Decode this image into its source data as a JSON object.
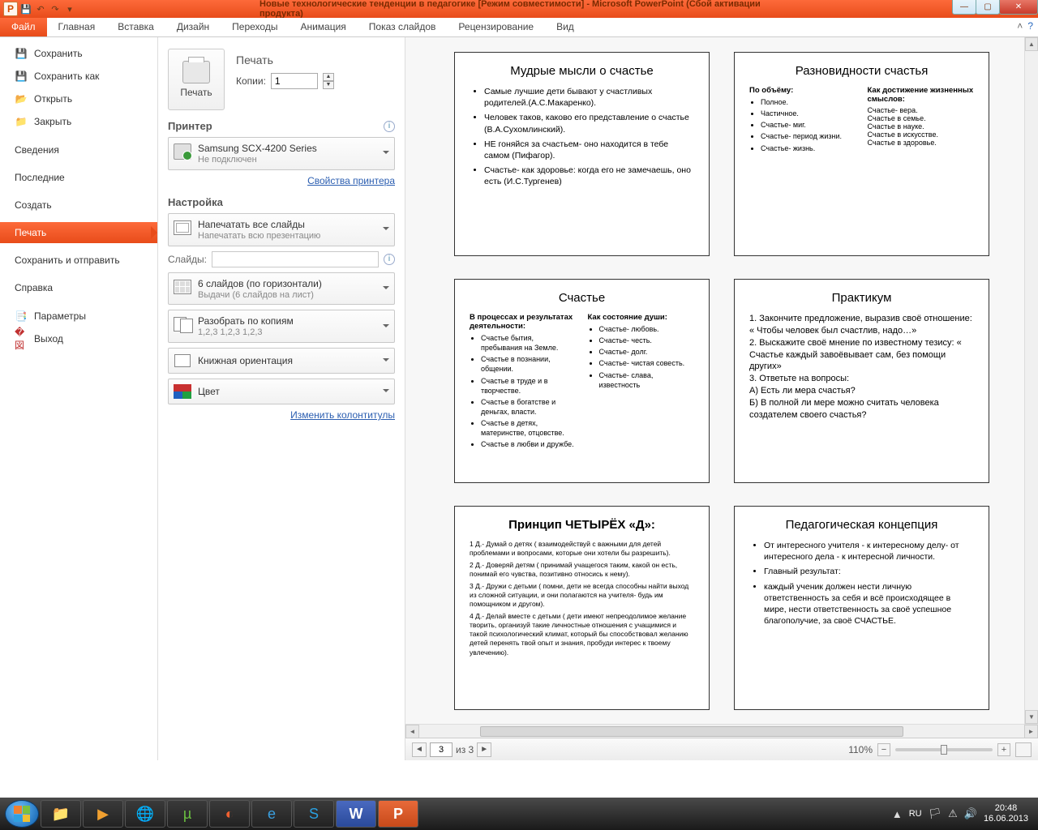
{
  "titlebar": {
    "title": "Новые технологические тенденции в педагогике [Режим совместимости]  -  Microsoft PowerPoint (Сбой активации продукта)"
  },
  "ribbon": {
    "file": "Файл",
    "tabs": [
      "Главная",
      "Вставка",
      "Дизайн",
      "Переходы",
      "Анимация",
      "Показ слайдов",
      "Рецензирование",
      "Вид"
    ]
  },
  "backstage_left": {
    "save": "Сохранить",
    "save_as": "Сохранить как",
    "open": "Открыть",
    "close": "Закрыть",
    "info": "Сведения",
    "recent": "Последние",
    "new": "Создать",
    "print": "Печать",
    "share": "Сохранить и отправить",
    "help": "Справка",
    "options": "Параметры",
    "exit": "Выход"
  },
  "print": {
    "heading": "Печать",
    "button": "Печать",
    "copies_label": "Копии:",
    "copies_value": "1",
    "printer_heading": "Принтер",
    "printer_name": "Samsung SCX-4200 Series",
    "printer_status": "Не подключен",
    "printer_props": "Свойства принтера",
    "settings_heading": "Настройка",
    "what_main": "Напечатать все слайды",
    "what_sub": "Напечатать всю презентацию",
    "slides_label": "Слайды:",
    "layout_main": "6 слайдов (по горизонтали)",
    "layout_sub": "Выдачи (6 слайдов на лист)",
    "collate_main": "Разобрать по копиям",
    "collate_sub": "1,2,3   1,2,3   1,2,3",
    "orientation": "Книжная ориентация",
    "color": "Цвет",
    "edit_hf": "Изменить колонтитулы"
  },
  "pager": {
    "page": "3",
    "of_label": "из 3",
    "zoom": "110%"
  },
  "slides": {
    "s1": {
      "title": "Мудрые мысли о счастье",
      "items": [
        "Самые лучшие дети бывают у счастливых родителей.(А.С.Макаренко).",
        "Человек таков, каково его представление о счастье (В.А.Сухомлинский).",
        "НЕ гоняйся за счастьем- оно находится в тебе самом (Пифагор).",
        "Счастье- как здоровье: когда его не замечаешь, оно есть (И.С.Тургенев)"
      ]
    },
    "s2": {
      "title": "Разновидности счастья",
      "col1_h": "По объёму:",
      "col1": [
        "Полное.",
        "Частичное.",
        "Счастье- миг.",
        "Счастье- период жизни.",
        "Счастье- жизнь."
      ],
      "col2_h": "Как достижение жизненных смыслов:",
      "col2": [
        "Счастье- вера.",
        "Счастье в семье.",
        "Счастье в науке.",
        "Счастье в искусстве.",
        "Счастье в здоровье."
      ]
    },
    "s3": {
      "title": "Счастье",
      "col1_h": "В процессах и результатах деятельности:",
      "col1": [
        "Счастье бытия, пребывания на Земле.",
        "Счастье в познании, общении.",
        "Счастье в труде и в творчестве.",
        "Счастье в богатстве и деньгах, власти.",
        "Счастье в детях, материнстве, отцовстве.",
        "Счастье в любви и дружбе."
      ],
      "col2_h": "Как состояние души:",
      "col2": [
        "Счастье- любовь.",
        "Счастье- честь.",
        "Счастье- долг.",
        "Счастье- чистая совесть.",
        "Счастье- слава, известность"
      ]
    },
    "s4": {
      "title": "Практикум",
      "lines": [
        "1. Закончите предложение, выразив своё отношение: « Чтобы человек был счастлив, надо…»",
        "2. Выскажите своё мнение по известному тезису: « Счастье каждый завоёвывает сам, без помощи других»",
        "3. Ответьте на вопросы:",
        "А) Есть ли мера счастья?",
        "Б) В полной ли мере можно считать человека создателем своего счастья?"
      ]
    },
    "s5": {
      "title": "Принцип  ЧЕТЫРЁХ «Д»:",
      "lines": [
        "1 Д.- Думай о детях ( взаимодействуй с важными для детей проблемами и вопросами, которые они хотели бы разрешить).",
        "2 Д.- Доверяй детям ( принимай учащегося таким, какой он есть, понимай его чувства, позитивно относись к нему).",
        "3 Д.- Дружи с детьми ( помни, дети не всегда способны найти выход из сложной ситуации, и они полагаются на учителя- будь им помощником и другом).",
        "4 Д.- Делай вместе с детьми ( дети имеют непреодолимое желание творить, организуй такие личностные отношения с учащимися и такой психологический климат, который бы способствовал желанию детей перенять твой опыт и знания, пробуди интерес к твоему увлечению)."
      ]
    },
    "s6": {
      "title": "Педагогическая концепция",
      "items": [
        "От интересного учителя - к интересному делу- от интересного дела - к интересной личности.",
        "Главный результат:",
        "каждый ученик должен нести личную ответственность за себя и всё происходящее в мире, нести ответственность за своё успешное благополучие, за своё СЧАСТЬЕ."
      ]
    }
  },
  "taskbar": {
    "lang": "RU",
    "time": "20:48",
    "date": "16.06.2013"
  }
}
